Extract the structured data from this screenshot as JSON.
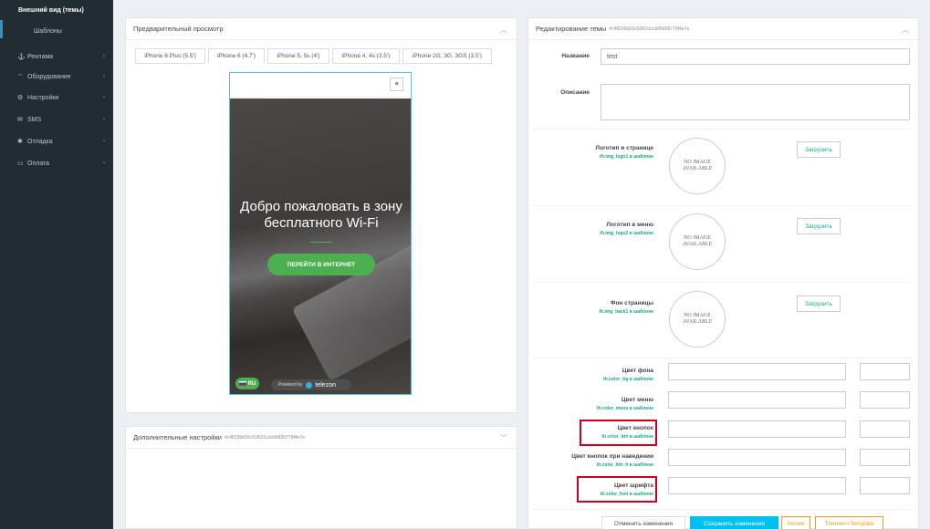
{
  "sidebar": {
    "submenu_active": "Внешний вид (темы)",
    "submenu_item": "Шаблоны",
    "items": [
      {
        "label": "Реклама",
        "icon": "anchor-icon"
      },
      {
        "label": "Оборудование",
        "icon": "wifi-icon"
      },
      {
        "label": "Настройки",
        "icon": "gears-icon"
      },
      {
        "label": "SMS",
        "icon": "envelope-icon"
      },
      {
        "label": "Отладка",
        "icon": "bug-icon"
      },
      {
        "label": "Оплата",
        "icon": "credit-card-icon"
      }
    ]
  },
  "preview": {
    "title": "Предварительный просмотр",
    "tabs": [
      "iPhone 6 Plus (5.5')",
      "iPhone 6 (4.7')",
      "iPhone 5, 5s (4')",
      "iPhone 4, 4s (3.5')",
      "iPhone 2G, 3G, 3GS (3.5')"
    ],
    "active_tab": "iPhone 6 (4.7')",
    "phone": {
      "welcome": "Добро пожаловать в зону бесплатного Wi-Fi",
      "button": "ПЕРЕЙТИ В ИНТЕРНЕТ",
      "lang": "RU",
      "powered_by": "Powered by",
      "brand": "telezon"
    }
  },
  "extra": {
    "title": "Дополнительные настройки",
    "id": "#c48199d16c91f631ccb06839779f4e7e"
  },
  "editor": {
    "title": "Редактирование темы",
    "id": "#c48199d16c91f631ccb06839779f4e7e",
    "name_label": "Название",
    "name_value": "test",
    "desc_label": "Описание",
    "images": [
      {
        "label": "Логотип в странице",
        "sub": "th.img_logo1 в шаблоне",
        "placeholder": "NO IMAGE AVAILABLE",
        "button": "Загрузить"
      },
      {
        "label": "Логотип в меню",
        "sub": "th.img_logo2 в шаблоне",
        "placeholder": "NO IMAGE AVAILABLE",
        "button": "Загрузить"
      },
      {
        "label": "Фон страницы",
        "sub": "th.img_back1 в шаблоне",
        "placeholder": "NO IMAGE AVAILABLE",
        "button": "Загрузить"
      }
    ],
    "colors": [
      {
        "label": "Цвет фона",
        "sub": "th.color_bg в шаблоне"
      },
      {
        "label": "Цвет меню",
        "sub": "th.color_menu в шаблоне"
      },
      {
        "label": "Цвет кнопок",
        "sub": "th.color_btn в шаблоне"
      },
      {
        "label": "Цвет кнопок при наведении",
        "sub": "th.color_btn_h в шаблоне"
      },
      {
        "label": "Цвет шрифта",
        "sub": "th.color_font в шаблоне"
      }
    ],
    "buttons": {
      "cancel": "Отменить изменения",
      "save": "Сохранить изменения",
      "copy": "Копия",
      "theme_template": "Theme=>Template"
    }
  },
  "colors": {
    "sidebar_bg": "#222d32",
    "accent_green": "#4caf50",
    "save_btn": "#00c0ef",
    "highlight_red": "#c9001e",
    "sub_label": "#17a589"
  }
}
